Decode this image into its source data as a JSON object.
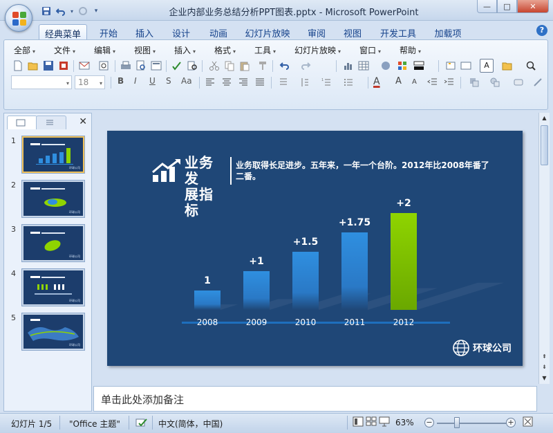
{
  "window": {
    "title": "企业内部业务总结分析PPT图表.pptx - Microsoft PowerPoint",
    "controls": {
      "minimize": "—",
      "maximize": "□",
      "close": "✕"
    }
  },
  "quick_access": {
    "more": "▾"
  },
  "ribbon_tabs": [
    {
      "label": "经典菜单",
      "active": true
    },
    {
      "label": "开始"
    },
    {
      "label": "插入"
    },
    {
      "label": "设计"
    },
    {
      "label": "动画"
    },
    {
      "label": "幻灯片放映"
    },
    {
      "label": "审阅"
    },
    {
      "label": "视图"
    },
    {
      "label": "开发工具"
    },
    {
      "label": "加载项"
    }
  ],
  "help": "?",
  "menus": [
    {
      "label": "全部"
    },
    {
      "label": "文件"
    },
    {
      "label": "编辑"
    },
    {
      "label": "视图"
    },
    {
      "label": "插入"
    },
    {
      "label": "格式"
    },
    {
      "label": "工具"
    },
    {
      "label": "幻灯片放映"
    },
    {
      "label": "窗口"
    },
    {
      "label": "帮助"
    }
  ],
  "format_bar": {
    "font_size": "18",
    "bold": "B",
    "italic": "I",
    "underline": "U",
    "shadow": "S",
    "case": "Aa",
    "font_color": "A",
    "grow": "A",
    "shrink": "A"
  },
  "toolbar": {
    "text_box_icon": "A"
  },
  "slides_panel": {
    "close": "✕",
    "thumbnails": [
      {
        "number": "1",
        "watermark": "环球公司",
        "selected": true
      },
      {
        "number": "2",
        "watermark": "环球公司"
      },
      {
        "number": "3",
        "watermark": "环球公司"
      },
      {
        "number": "4",
        "watermark": "环球公司"
      },
      {
        "number": "5",
        "watermark": "环球公司"
      }
    ]
  },
  "slide": {
    "title_line1": "业务发",
    "title_line2": "展指标",
    "description": "业务取得长足进步。五年来，一年一个台阶。2012年比2008年番了二番。",
    "company": "环球公司",
    "background": "#1f4777",
    "bar_color": "#2f8fe0",
    "highlight_color": "#8fd400"
  },
  "chart_data": {
    "type": "bar",
    "categories": [
      "2008",
      "2009",
      "2010",
      "2011",
      "2012"
    ],
    "values": [
      1,
      2,
      3,
      4,
      5
    ],
    "data_labels": [
      "1",
      "+1",
      "+1.5",
      "+1.75",
      "+2"
    ],
    "highlight_index": 4
  },
  "notes": {
    "placeholder": "单击此处添加备注"
  },
  "status": {
    "slide_info": "幻灯片 1/5",
    "theme": "\"Office 主题\"",
    "language": "中文(简体，中国)",
    "zoom": "63%",
    "zoom_out": "−",
    "zoom_in": "+"
  }
}
